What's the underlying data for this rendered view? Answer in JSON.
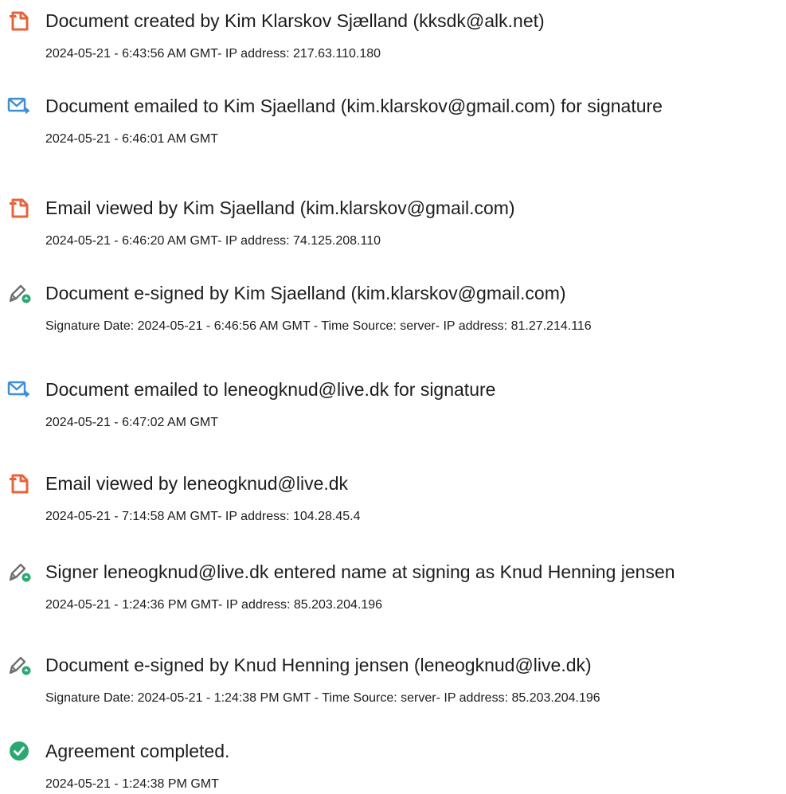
{
  "events": [
    {
      "icon": "document-icon",
      "title": "Document created by Kim Klarskov Sjælland (kksdk@alk.net)",
      "detail": "2024-05-21 - 6:43:56 AM GMT- IP address: 217.63.110.180"
    },
    {
      "icon": "email-sent-icon",
      "title": "Document emailed to Kim Sjaelland (kim.klarskov@gmail.com) for signature",
      "detail": "2024-05-21 - 6:46:01 AM GMT"
    },
    {
      "icon": "document-icon",
      "title": "Email viewed by Kim Sjaelland (kim.klarskov@gmail.com)",
      "detail": "2024-05-21 - 6:46:20 AM GMT- IP address: 74.125.208.110"
    },
    {
      "icon": "esign-pen-icon",
      "title": "Document e-signed by Kim Sjaelland (kim.klarskov@gmail.com)",
      "detail": "Signature Date: 2024-05-21 - 6:46:56 AM GMT - Time Source: server- IP address: 81.27.214.116"
    },
    {
      "icon": "email-sent-icon",
      "title": "Document emailed to leneogknud@live.dk for signature",
      "detail": "2024-05-21 - 6:47:02 AM GMT"
    },
    {
      "icon": "document-icon",
      "title": "Email viewed by leneogknud@live.dk",
      "detail": "2024-05-21 - 7:14:58 AM GMT- IP address: 104.28.45.4"
    },
    {
      "icon": "esign-pen-icon",
      "title": "Signer leneogknud@live.dk entered name at signing as Knud Henning jensen",
      "detail": "2024-05-21 - 1:24:36 PM GMT- IP address: 85.203.204.196"
    },
    {
      "icon": "esign-pen-icon",
      "title": "Document e-signed by Knud Henning jensen (leneogknud@live.dk)",
      "detail": "Signature Date: 2024-05-21 - 1:24:38 PM GMT - Time Source: server- IP address: 85.203.204.196"
    },
    {
      "icon": "checkmark-circle-icon",
      "title": "Agreement completed.",
      "detail": "2024-05-21 - 1:24:38 PM GMT"
    }
  ],
  "colors": {
    "document_icon": "#e8633a",
    "email_icon": "#3f8fd8",
    "pen_icon": "#6f6f6f",
    "pen_badge": "#2aa872",
    "check_icon": "#2aa872",
    "text": "#1d1d1d"
  }
}
